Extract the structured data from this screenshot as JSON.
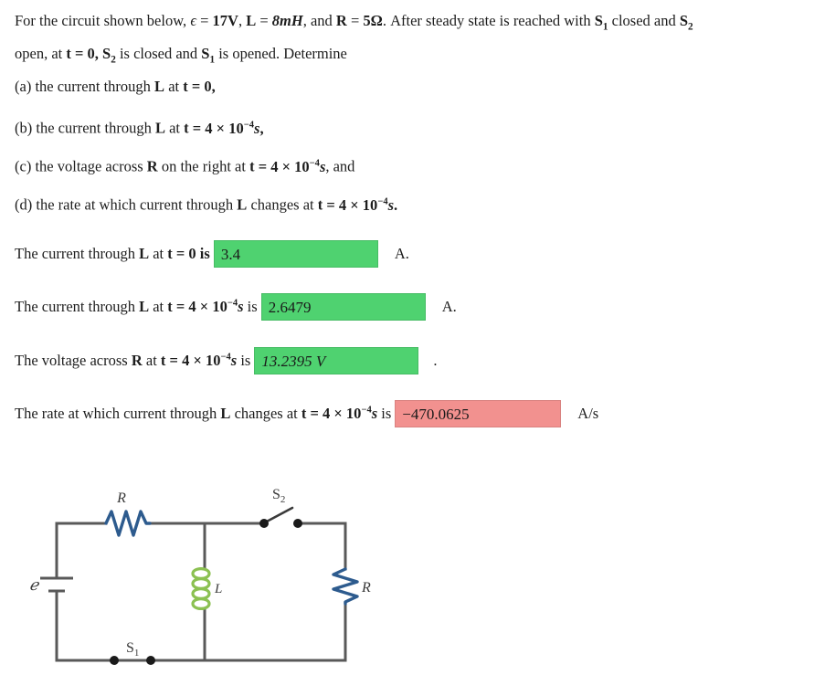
{
  "problem": {
    "line1_pre": "For the circuit shown below, ",
    "eps_sym": "ϵ",
    "eq1": " = ",
    "eps_value": "17V",
    "comma1": ", ",
    "L_sym": "L",
    "L_value": "8mH",
    "comma2": ", and ",
    "R_sym": "R",
    "R_value": "5Ω",
    "line1_post": ". After steady state is reached with ",
    "S1": "S",
    "S1_sub": "1",
    "mid1": " closed and ",
    "S2": "S",
    "S2_sub": "2",
    "line2": "open, at t = 0, S2 is closed and S1 is opened. Determine",
    "line2_pre": "open, at ",
    "t_sym": "t",
    "t_zero": " = 0, ",
    "line2_mid": " is closed and ",
    "line2_post": " is opened. Determine"
  },
  "questions": [
    {
      "label": "(a)",
      "text_pre": " the current through ",
      "var": "L",
      "text_mid": " at ",
      "tvar": "t",
      "time": " = 0,",
      "time_value": "0",
      "full": "(a) the current through L at t = 0,"
    },
    {
      "label": "(b)",
      "text_pre": " the current through ",
      "var": "L",
      "text_mid": " at ",
      "tvar": "t",
      "time_value": "4 × 10⁻⁴s,",
      "full": "(b) the current through L at t = 4 × 10⁻⁴s,"
    },
    {
      "label": "(c)",
      "text_pre": " the voltage across ",
      "var": "R",
      "text_mid": " on the right at ",
      "tvar": "t",
      "time_value": "4 × 10⁻⁴s, and",
      "full": "(c) the voltage across R on the right at t = 4 × 10⁻⁴s, and"
    },
    {
      "label": "(d)",
      "text_pre": " the rate at which current through ",
      "var": "L",
      "text_mid": " changes at ",
      "tvar": "t",
      "time_value": "4 × 10⁻⁴s.",
      "full": "(d) the rate at which current through L changes at t = 4 × 10⁻⁴s."
    }
  ],
  "answers": [
    {
      "prompt_1": "The current through ",
      "var": "L",
      "prompt_2": " at ",
      "tvar": "t",
      "time": " = 0 is",
      "value": "3.4",
      "unit": "A.",
      "status": "correct",
      "status_color": "#4fd270"
    },
    {
      "prompt_1": "The current through ",
      "var": "L",
      "prompt_2": " at ",
      "tvar": "t",
      "time": " = 4 × 10⁻⁴s is",
      "value": "2.6479",
      "unit": "A.",
      "status": "correct",
      "status_color": "#4fd270"
    },
    {
      "prompt_1": "The voltage across ",
      "var": "R",
      "prompt_2": " at ",
      "tvar": "t",
      "time": " = 4 × 10⁻⁴s is",
      "value": "13.2395 V",
      "unit": ".",
      "status": "correct",
      "status_color": "#4fd270"
    },
    {
      "prompt_1": "The rate at which current through ",
      "var": "L",
      "prompt_2": " changes at ",
      "tvar": "t",
      "time": " = 4 × 10⁻⁴s is",
      "value": "−470.0625",
      "unit": "A/s",
      "status": "incorrect",
      "status_color": "#f2918f"
    }
  ],
  "circuit": {
    "labels": {
      "emf": "ℰ",
      "resistor_top": "R",
      "inductor": "L",
      "switch_top": "S",
      "switch_top_sub": "2",
      "resistor_right": "R",
      "switch_bottom": "S",
      "switch_bottom_sub": "1"
    },
    "colors": {
      "wire": "#595959",
      "resistor": "#2d5b8e",
      "inductor": "#8cc152",
      "node": "#1a1a1a"
    }
  }
}
